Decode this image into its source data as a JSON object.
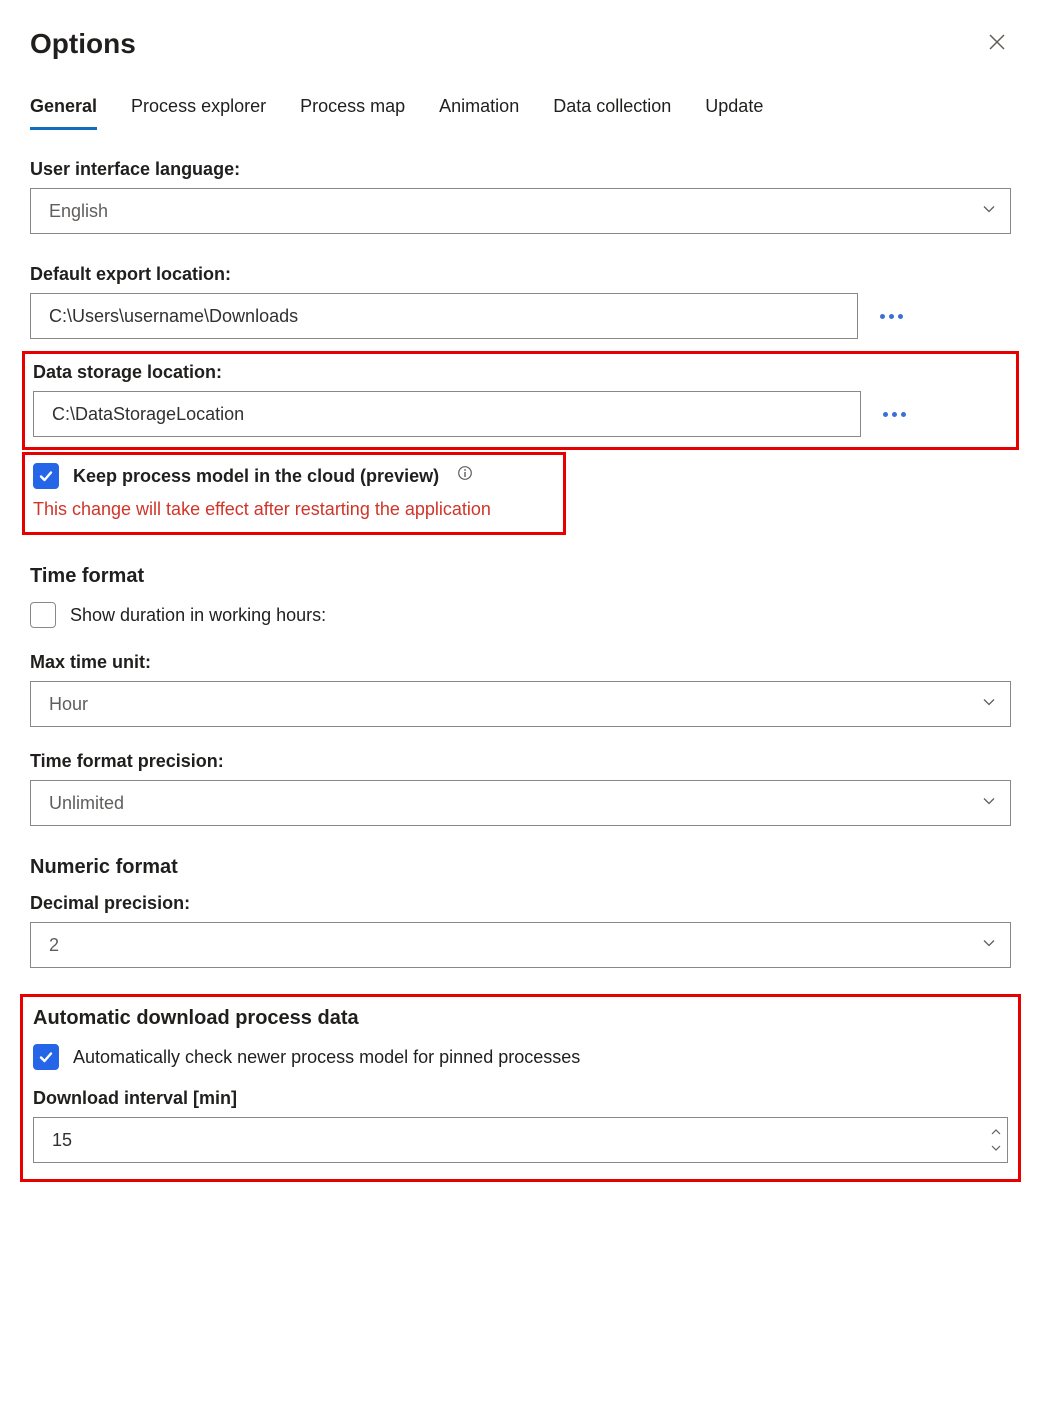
{
  "header": {
    "title": "Options"
  },
  "tabs": {
    "items": [
      {
        "label": "General",
        "active": true
      },
      {
        "label": "Process explorer",
        "active": false
      },
      {
        "label": "Process map",
        "active": false
      },
      {
        "label": "Animation",
        "active": false
      },
      {
        "label": "Data collection",
        "active": false
      },
      {
        "label": "Update",
        "active": false
      }
    ]
  },
  "general": {
    "language_label": "User interface language:",
    "language_value": "English",
    "export_label": "Default export location:",
    "export_value": "C:\\Users\\username\\Downloads",
    "storage_label": "Data storage location:",
    "storage_value": "C:\\DataStorageLocation",
    "cloud_checkbox_label": "Keep process model in the cloud (preview)",
    "cloud_checkbox_checked": true,
    "cloud_warning": "This change will take effect after restarting the application",
    "time_format_heading": "Time format",
    "show_duration_label": "Show duration in working hours:",
    "show_duration_checked": false,
    "max_time_unit_label": "Max time unit:",
    "max_time_unit_value": "Hour",
    "precision_label": "Time format precision:",
    "precision_value": "Unlimited",
    "numeric_heading": "Numeric format",
    "decimal_label": "Decimal precision:",
    "decimal_value": "2",
    "auto_download_heading": "Automatic download process data",
    "auto_check_label": "Automatically check newer process model for pinned processes",
    "auto_check_checked": true,
    "interval_label": "Download interval [min]",
    "interval_value": "15"
  }
}
